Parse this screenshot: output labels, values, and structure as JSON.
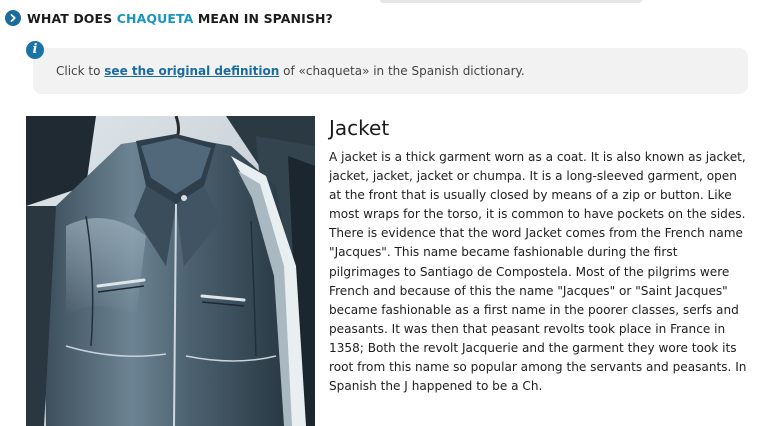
{
  "heading": {
    "prefix": "WHAT DOES ",
    "highlight": "CHAQUETA",
    "suffix": " MEAN IN SPANISH?"
  },
  "info": {
    "lead": "Click to ",
    "link": "see the original definition",
    "rest": " of «chaqueta» in the Spanish dictionary."
  },
  "definition": {
    "title": "Jacket",
    "body": "A jacket is a thick garment worn as a coat. It is also known as jacket, jacket, jacket, jacket or chumpa. It is a long-sleeved garment, open at the front that is usually closed by means of a zip or button. Like most wraps for the torso, it is common to have pockets on the sides. There is evidence that the word Jacket comes from the French name \"Jacques\". This name became fashionable during the first pilgrimages to Santiago de Compostela. Most of the pilgrims were French and because of this the name \"Jacques\" or \"Saint Jacques\" became fashionable as a first name in the poorer classes, serfs and peasants. It was then that peasant revolts took place in France in 1358; Both the revolt Jacquerie and the garment they wore took its root from this name so popular among the servants and peasants. In Spanish the J happened to be a Ch."
  },
  "colors": {
    "accent": "#1a95c2",
    "icon": "#1a73a8",
    "panel": "#f2f2f2"
  },
  "icons": {
    "heading": "chevron-right-icon",
    "info": "info-icon"
  }
}
